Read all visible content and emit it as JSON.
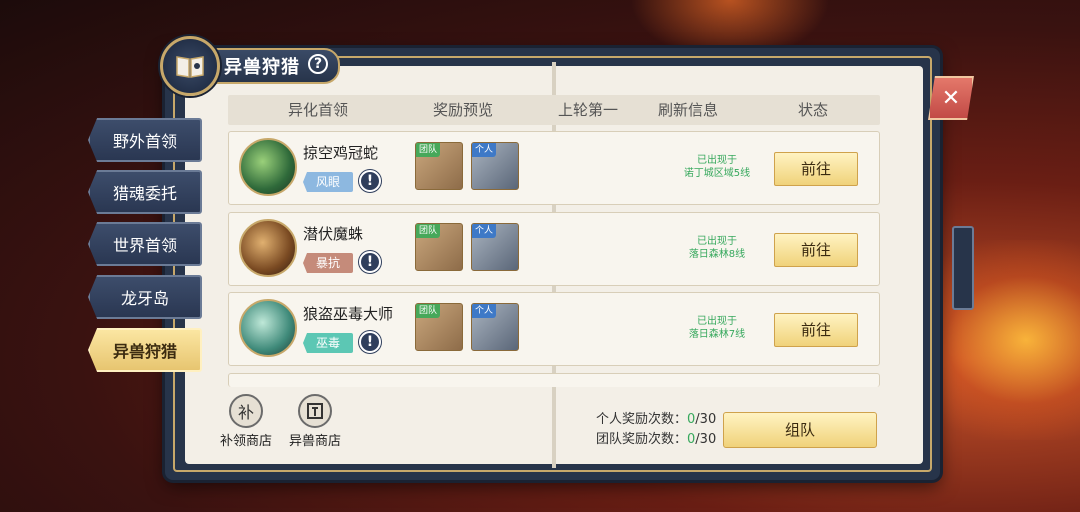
{
  "window": {
    "title": "异兽狩猎",
    "help_label": "?"
  },
  "side_tabs": [
    {
      "label": "野外首领",
      "active": false
    },
    {
      "label": "猎魂委托",
      "active": false
    },
    {
      "label": "世界首领",
      "active": false
    },
    {
      "label": "龙牙岛",
      "active": false
    },
    {
      "label": "异兽狩猎",
      "active": true
    }
  ],
  "table": {
    "headers": [
      "异化首领",
      "奖励预览",
      "上轮第一",
      "刷新信息",
      "状态"
    ],
    "rows": [
      {
        "name": "掠空鸡冠蛇",
        "tag": "风眼",
        "tag_color": "#8db8e0",
        "warn": "!",
        "reward_team_badge": "团队",
        "reward_personal_badge": "个人",
        "last_first": "",
        "refresh_line1": "已出现于",
        "refresh_line2": "诺丁城区域5线",
        "action": "前往"
      },
      {
        "name": "潜伏魔蛛",
        "tag": "暴抗",
        "tag_color": "#c58b7a",
        "warn": "!",
        "reward_team_badge": "团队",
        "reward_personal_badge": "个人",
        "last_first": "",
        "refresh_line1": "已出现于",
        "refresh_line2": "落日森林8线",
        "action": "前往"
      },
      {
        "name": "狼盗巫毒大师",
        "tag": "巫毒",
        "tag_color": "#5cc7b4",
        "warn": "!",
        "reward_team_badge": "团队",
        "reward_personal_badge": "个人",
        "last_first": "",
        "refresh_line1": "已出现于",
        "refresh_line2": "落日森林7线",
        "action": "前往"
      }
    ]
  },
  "footer": {
    "shop1_icon": "补",
    "shop1_label": "补领商店",
    "shop2_label": "异兽商店",
    "personal_label": "个人奖励次数：",
    "personal_count": "0",
    "personal_total": "/30",
    "team_label": "团队奖励次数：",
    "team_count": "0",
    "team_total": "/30",
    "team_button": "组队"
  },
  "close_label": "✕"
}
